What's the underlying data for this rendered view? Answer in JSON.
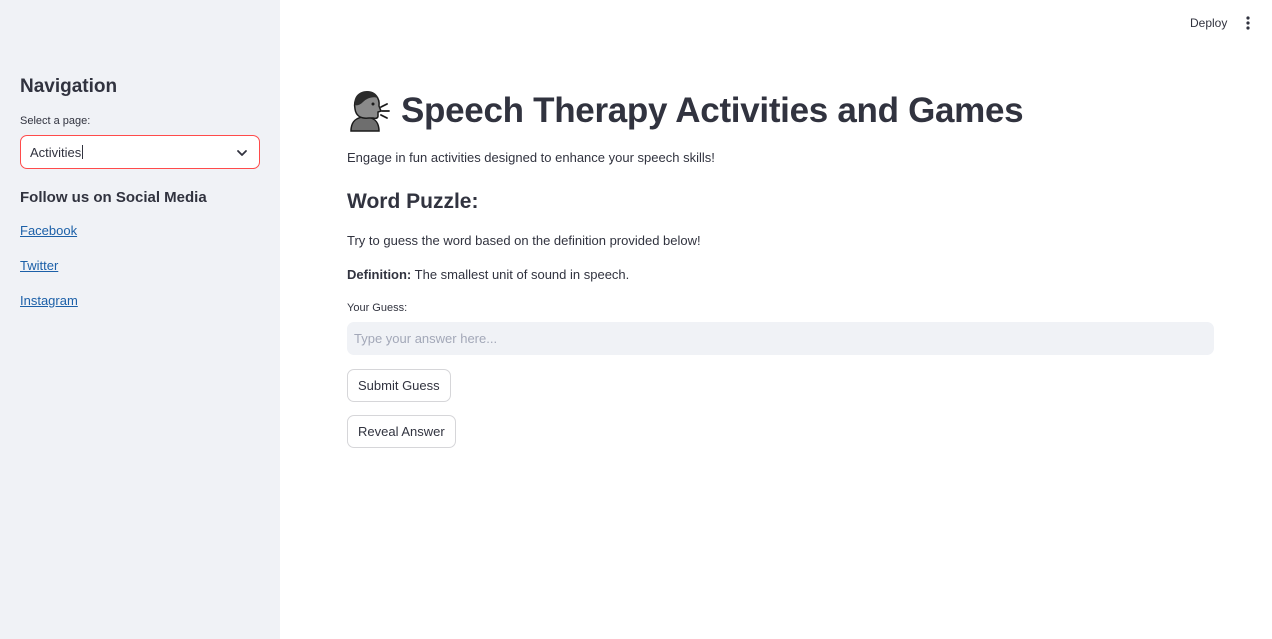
{
  "sidebar": {
    "title": "Navigation",
    "select": {
      "label": "Select a page:",
      "value": "Activities"
    },
    "social_heading": "Follow us on Social Media",
    "links": [
      {
        "label": "Facebook"
      },
      {
        "label": "Twitter"
      },
      {
        "label": "Instagram"
      }
    ]
  },
  "header": {
    "deploy_label": "Deploy",
    "menu_icon": "kebab-menu-icon"
  },
  "main": {
    "title": "Speech Therapy Activities and Games",
    "title_icon": "speaking-head-emoji",
    "subtitle": "Engage in fun activities designed to enhance your speech skills!",
    "section_heading": "Word Puzzle:",
    "instruction": "Try to guess the word based on the definition provided below!",
    "definition_label": "Definition:",
    "definition_text": " The smallest unit of sound in speech.",
    "guess_label": "Your Guess:",
    "guess_value": "",
    "guess_placeholder": "Type your answer here...",
    "submit_label": "Submit Guess",
    "reveal_label": "Reveal Answer"
  },
  "colors": {
    "accent": "#ff4b4b",
    "link": "#1c60a8",
    "sidebar_bg": "#f0f2f6",
    "text": "#31333f"
  }
}
